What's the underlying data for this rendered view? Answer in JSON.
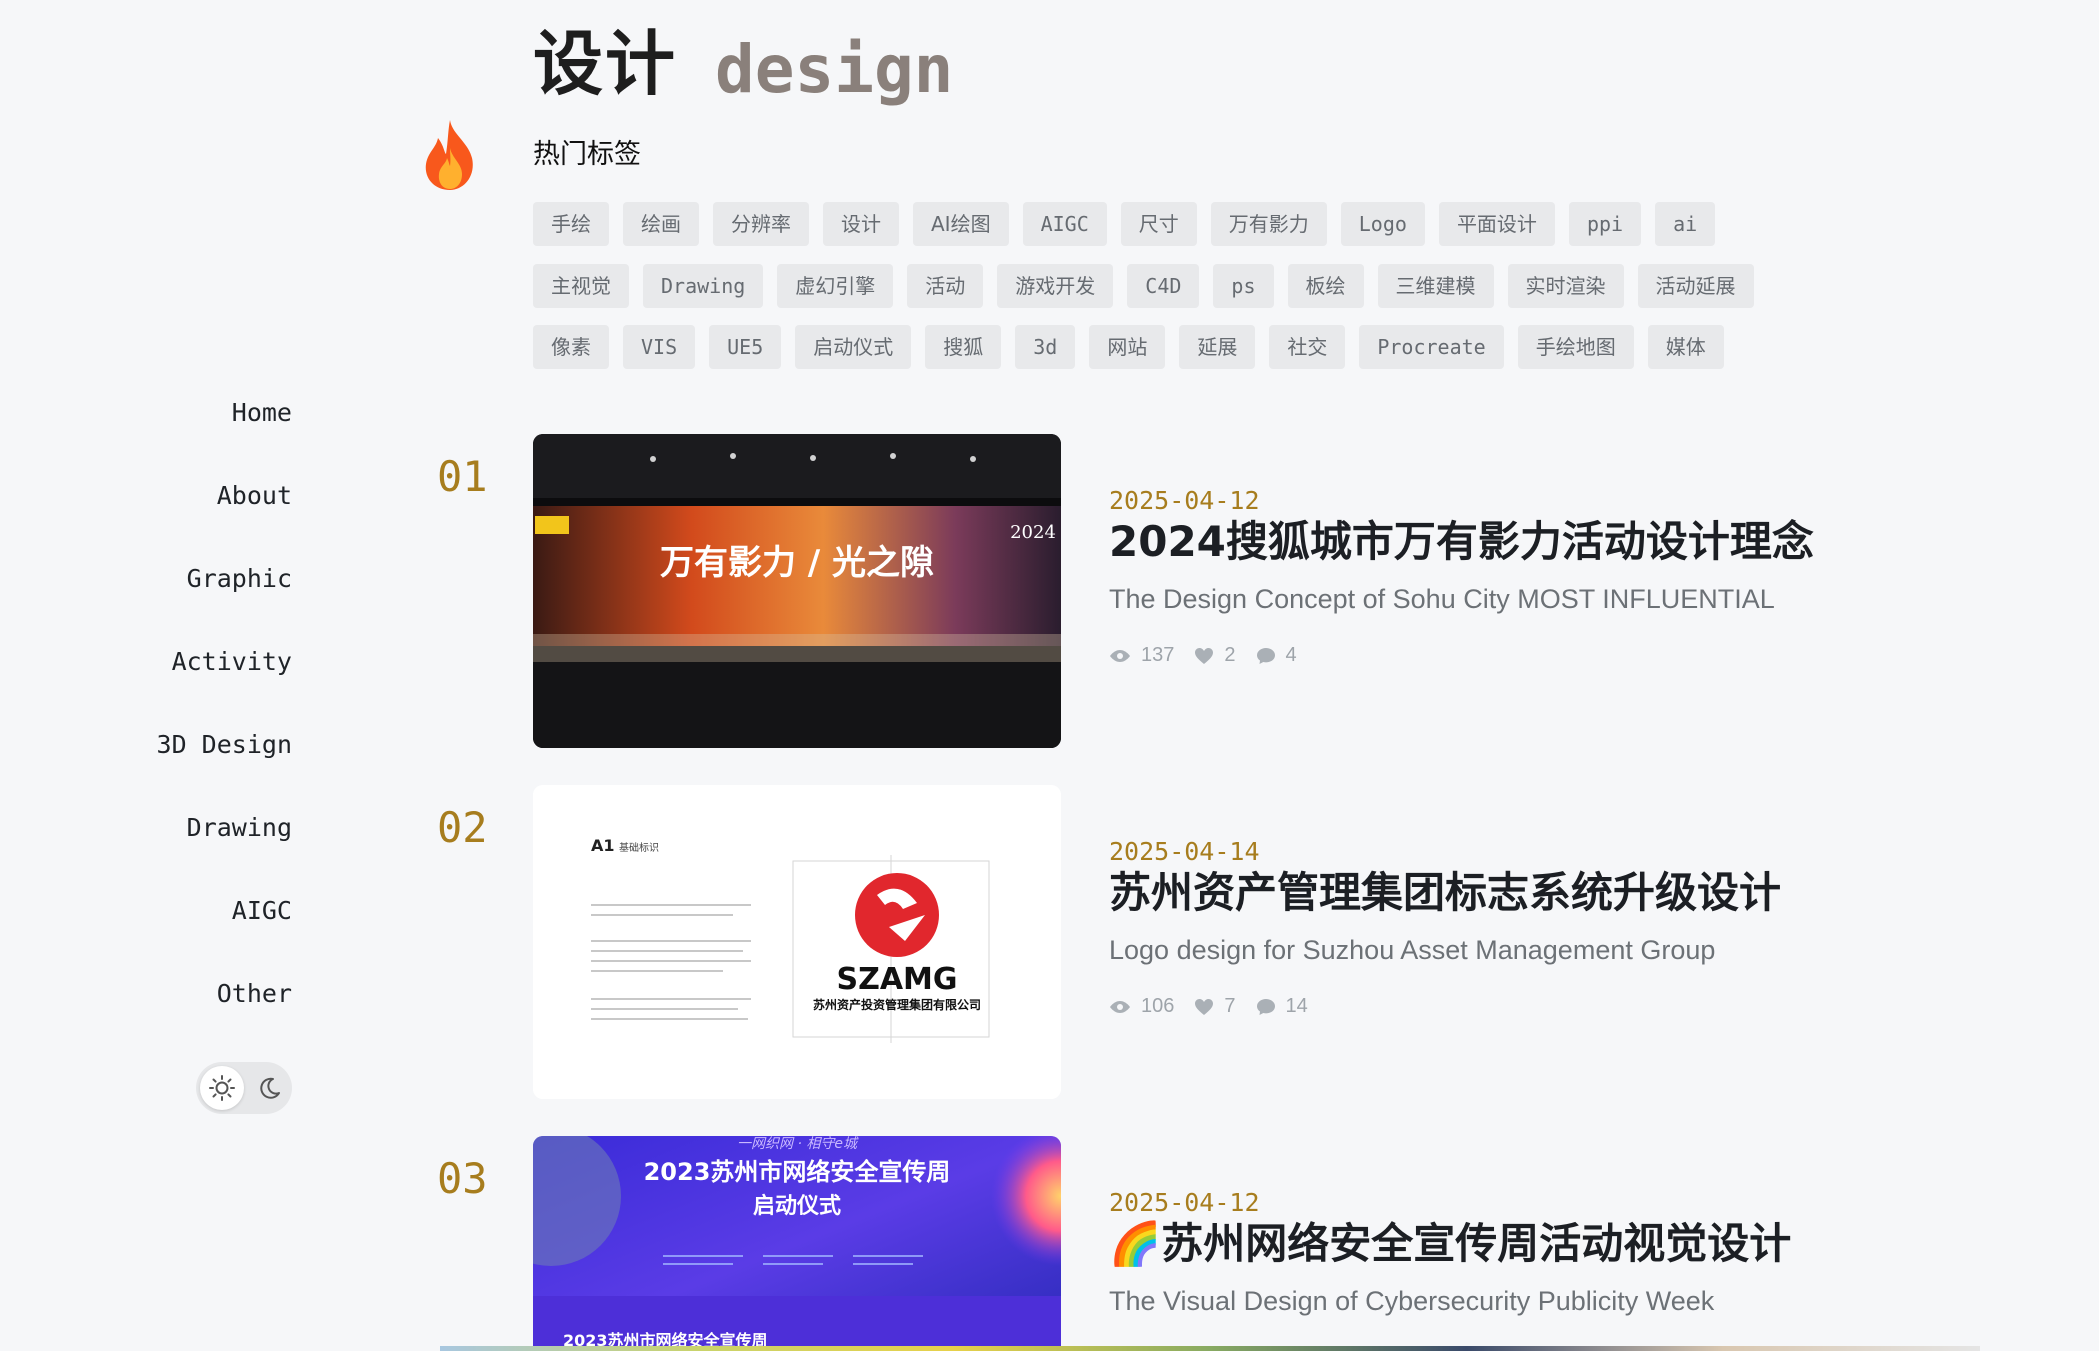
{
  "header": {
    "title_zh": "设计",
    "title_en": "design"
  },
  "hot_tags": {
    "label": "热门标签",
    "rows": [
      [
        "手绘",
        "绘画",
        "分辨率",
        "设计",
        "AI绘图",
        "AIGC",
        "尺寸",
        "万有影力",
        "Logo",
        "平面设计",
        "ppi",
        "ai"
      ],
      [
        "主视觉",
        "Drawing",
        "虚幻引擎",
        "活动",
        "游戏开发",
        "C4D",
        "ps",
        "板绘",
        "三维建模",
        "实时渲染",
        "活动延展"
      ],
      [
        "像素",
        "VIS",
        "UE5",
        "启动仪式",
        "搜狐",
        "3d",
        "网站",
        "延展",
        "社交",
        "Procreate",
        "手绘地图",
        "媒体"
      ]
    ]
  },
  "nav": {
    "items": [
      "Home",
      "About",
      "Graphic",
      "Activity",
      "3D Design",
      "Drawing",
      "AIGC",
      "Other"
    ]
  },
  "posts": [
    {
      "num": "01",
      "date": "2025-04-12",
      "title": "2024搜狐城市万有影力活动设计理念",
      "subtitle": "The Design Concept of Sohu City MOST INFLUENTIAL",
      "views": "137",
      "likes": "2",
      "comments": "4",
      "thumb_text": "万有影力 / 光之隙",
      "thumb_year": "2024"
    },
    {
      "num": "02",
      "date": "2025-04-14",
      "title": "苏州资产管理集团标志系统升级设计",
      "subtitle": "Logo design for Suzhou Asset Management Group",
      "views": "106",
      "likes": "7",
      "comments": "14",
      "thumb_heading": "A1",
      "thumb_heading_sub": "基础标识",
      "thumb_logo": "SZAMG",
      "thumb_company": "苏州资产投资管理集团有限公司"
    },
    {
      "num": "03",
      "date": "2025-04-12",
      "title": "🌈苏州网络安全宣传周活动视觉设计",
      "subtitle": "The Visual Design of Cybersecurity Publicity Week",
      "thumb_slogan": "一网织网 · 相守e城",
      "thumb_title1": "2023苏州市网络安全宣传周",
      "thumb_title2": "启动仪式",
      "thumb_title3": "2023苏州市网络安全宣传周"
    }
  ],
  "colors": {
    "accent": "#a77d1e",
    "background": "#f6f7f9",
    "tag_bg": "#e8e9eb"
  }
}
